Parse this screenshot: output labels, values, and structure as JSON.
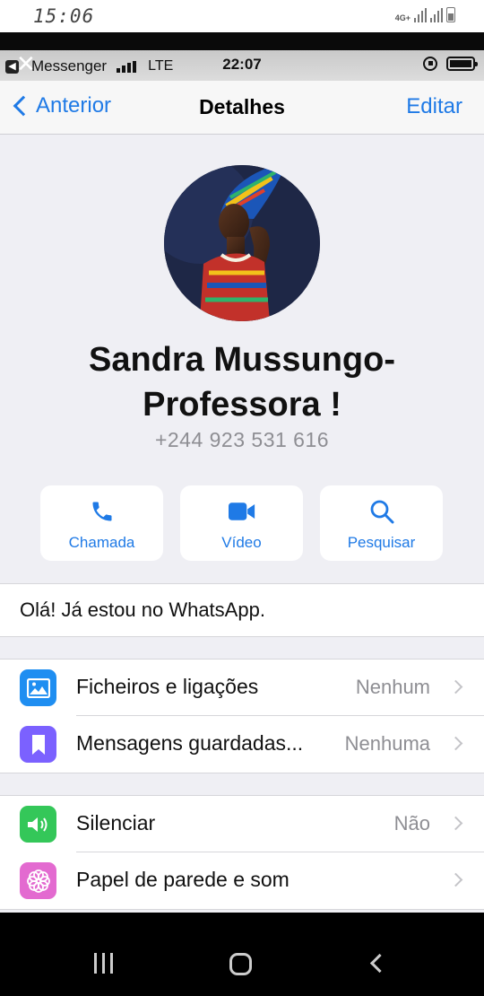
{
  "android_status": {
    "time": "15:06",
    "network": "4G+"
  },
  "ios_status": {
    "back_app": "Messenger",
    "carrier": "LTE",
    "time": "22:07"
  },
  "navbar": {
    "back_label": "Anterior",
    "title": "Detalhes",
    "edit_label": "Editar"
  },
  "contact": {
    "name_line1": "Sandra Mussungo-",
    "name_line2": "Professora !",
    "phone": "+244 923 531 616",
    "avatar_icon": "profile-photo"
  },
  "actions": [
    {
      "label": "Chamada",
      "icon": "phone-icon"
    },
    {
      "label": "Vídeo",
      "icon": "video-icon"
    },
    {
      "label": "Pesquisar",
      "icon": "search-icon"
    }
  ],
  "about": "Olá! Já estou no WhatsApp.",
  "groups": [
    {
      "rows": [
        {
          "label": "Ficheiros e ligações",
          "value": "Nenhum",
          "icon": "photo-icon",
          "color": "#1f8ef1"
        },
        {
          "label": "Mensagens guardadas...",
          "value": "Nenhuma",
          "icon": "bookmark-icon",
          "color": "#7b61ff"
        }
      ]
    },
    {
      "rows": [
        {
          "label": "Silenciar",
          "value": "Não",
          "icon": "speaker-icon",
          "color": "#34c759"
        },
        {
          "label": "Papel de parede e som",
          "value": "",
          "icon": "flower-icon",
          "color": "#e36ad0"
        }
      ]
    }
  ],
  "colors": {
    "accent": "#1f7ae6",
    "background": "#efeff4"
  }
}
